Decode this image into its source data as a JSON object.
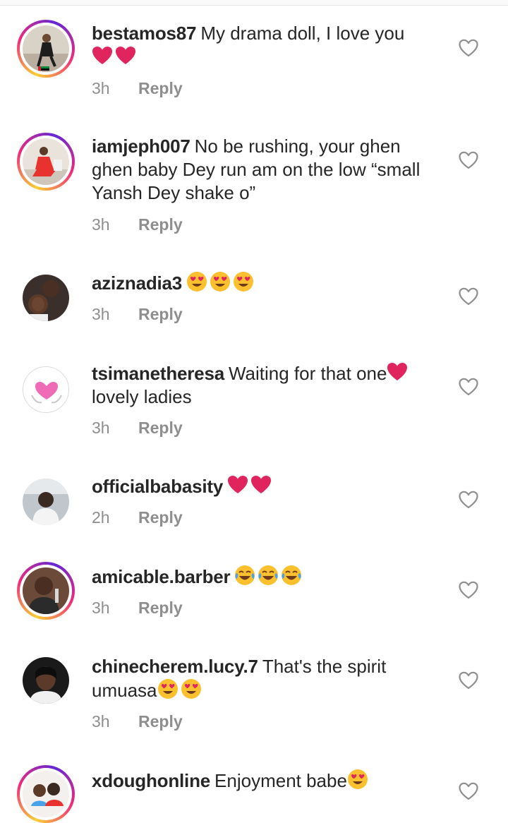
{
  "reply_label": "Reply",
  "colors": {
    "text": "#262626",
    "meta": "#8e8e8e",
    "heart_emoji": "#e0245e",
    "ring_start": "#f9ce34",
    "ring_mid": "#ee2a7b",
    "ring_end": "#6228d7"
  },
  "comments": [
    {
      "username": "bestamos87",
      "text": "My drama doll, I love you",
      "emojis": [
        "red-heart",
        "red-heart"
      ],
      "time": "3h",
      "story_ring": true
    },
    {
      "username": "iamjeph007",
      "text": "No be rushing, your ghen ghen baby Dey run am on the low “small Yansh Dey shake o”",
      "emojis": [],
      "time": "3h",
      "story_ring": true
    },
    {
      "username": "aziznadia3",
      "text": "",
      "emojis": [
        "heart-eyes",
        "heart-eyes",
        "heart-eyes"
      ],
      "time": "3h",
      "story_ring": false
    },
    {
      "username": "tsimanetheresa",
      "text": "Waiting for that one",
      "emojis": [
        "red-heart"
      ],
      "text_after": "lovely ladies",
      "time": "3h",
      "story_ring": false
    },
    {
      "username": "officialbabasity",
      "text": "",
      "emojis": [
        "red-heart",
        "red-heart"
      ],
      "time": "2h",
      "story_ring": false
    },
    {
      "username": "amicable.barber",
      "text": "",
      "emojis": [
        "tears-of-joy",
        "tears-of-joy",
        "tears-of-joy"
      ],
      "time": "3h",
      "story_ring": true
    },
    {
      "username": "chinecherem.lucy.7",
      "text": "That's the spirit umuasa",
      "emojis": [
        "heart-eyes",
        "heart-eyes"
      ],
      "time": "3h",
      "story_ring": false
    },
    {
      "username": "xdoughonline",
      "text": "Enjoyment babe",
      "emojis": [
        "heart-eyes"
      ],
      "time": "",
      "story_ring": true
    }
  ]
}
